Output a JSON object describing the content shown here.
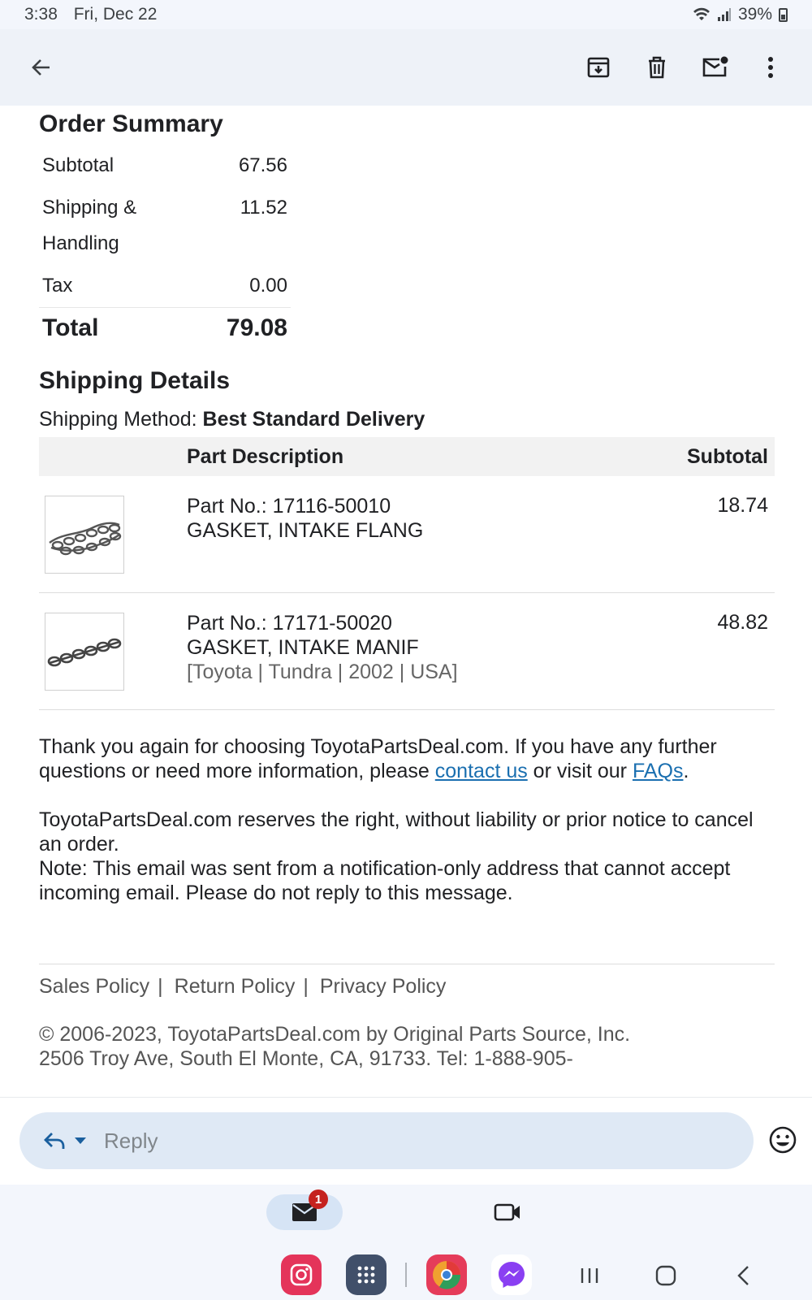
{
  "status_bar": {
    "time": "3:38",
    "date": "Fri, Dec 22",
    "battery": "39%",
    "icons": [
      "wifi-icon",
      "signal-icon",
      "battery-icon"
    ]
  },
  "app_bar": {
    "icons": [
      "back-arrow-icon",
      "archive-icon",
      "trash-icon",
      "mark-unread-icon",
      "more-vert-icon"
    ]
  },
  "order_summary": {
    "title": "Order Summary",
    "rows": [
      {
        "label": "Subtotal",
        "value": "67.56"
      },
      {
        "label": "Shipping & Handling",
        "value": "11.52"
      },
      {
        "label": "Tax",
        "value": "0.00"
      }
    ],
    "total_label": "Total",
    "total_value": "79.08"
  },
  "shipping": {
    "title": "Shipping Details",
    "method_label": "Shipping Method: ",
    "method_value": "Best Standard Delivery",
    "col_description": "Part Description",
    "col_subtotal": "Subtotal",
    "items": [
      {
        "part_no": "Part No.: 17116-50010",
        "name": "GASKET, INTAKE FLANG",
        "vehicle": "",
        "price": "18.74",
        "thumb": "gasket-chain-image"
      },
      {
        "part_no": "Part No.: 17171-50020",
        "name": "GASKET, INTAKE MANIF",
        "vehicle": "[Toyota | Tundra | 2002 | USA]",
        "price": "48.82",
        "thumb": "gasket-chain-image"
      }
    ]
  },
  "messages": {
    "thanks_pre": "Thank you again for choosing ToyotaPartsDeal.com. If you have any further questions or need more information, please ",
    "contact_link": "contact us",
    "thanks_mid": " or visit our ",
    "faq_link": "FAQs",
    "thanks_post": ".",
    "rights": "ToyotaPartsDeal.com reserves the right, without liability or prior notice to cancel an order.",
    "note": "Note: This email was sent from a notification-only address that cannot accept incoming email. Please do not reply to this message."
  },
  "footer": {
    "links": [
      "Sales Policy",
      "Return Policy",
      "Privacy Policy"
    ],
    "separator": "|",
    "copyright": "© 2006-2023, ToyotaPartsDeal.com by Original Parts Source, Inc.",
    "address": "2506 Troy Ave, South El Monte, CA, 91733. Tel: 1-888-905-"
  },
  "reply_bar": {
    "placeholder": "Reply",
    "icons": [
      "reply-icon",
      "dropdown-caret-icon",
      "emoji-icon"
    ]
  },
  "bottom_nav": {
    "mail_badge": "1",
    "tabs": [
      "mail-icon",
      "meet-video-icon"
    ],
    "dock_apps": [
      "instagram-icon",
      "app-drawer-icon",
      "chrome-canary-icon",
      "messenger-icon"
    ],
    "system": [
      "recents-icon",
      "home-icon",
      "back-icon"
    ]
  },
  "colors": {
    "link": "#1a6fb0",
    "badge": "#c5221f",
    "reply_pill": "#dfe9f5"
  }
}
